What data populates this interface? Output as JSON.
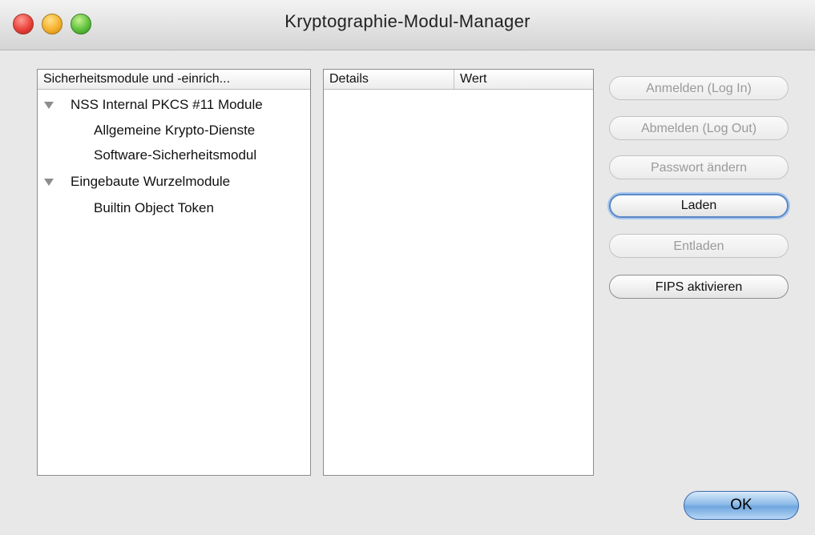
{
  "window": {
    "title": "Kryptographie-Modul-Manager"
  },
  "modules_tree": {
    "header": "Sicherheitsmodule und -einrich...",
    "items": [
      {
        "label": "NSS Internal PKCS #11 Module",
        "level": 0,
        "expanded": true
      },
      {
        "label": "Allgemeine Krypto-Dienste",
        "level": 1
      },
      {
        "label": "Software-Sicherheitsmodul",
        "level": 1
      },
      {
        "label": "Eingebaute Wurzelmodule",
        "level": 0,
        "expanded": true
      },
      {
        "label": "Builtin Object Token",
        "level": 1
      }
    ]
  },
  "details_table": {
    "columns": [
      "Details",
      "Wert"
    ],
    "rows": []
  },
  "buttons": {
    "login": {
      "label": "Anmelden (Log In)",
      "enabled": false
    },
    "logout": {
      "label": "Abmelden (Log Out)",
      "enabled": false
    },
    "change_password": {
      "label": "Passwort ändern",
      "enabled": false
    },
    "load": {
      "label": "Laden",
      "enabled": true
    },
    "unload": {
      "label": "Entladen",
      "enabled": false
    },
    "fips": {
      "label": "FIPS aktivieren",
      "enabled": true
    },
    "ok": {
      "label": "OK",
      "enabled": true
    }
  },
  "colors": {
    "focus_ring": "#5a88c6",
    "default_button": "#6fa6de"
  }
}
